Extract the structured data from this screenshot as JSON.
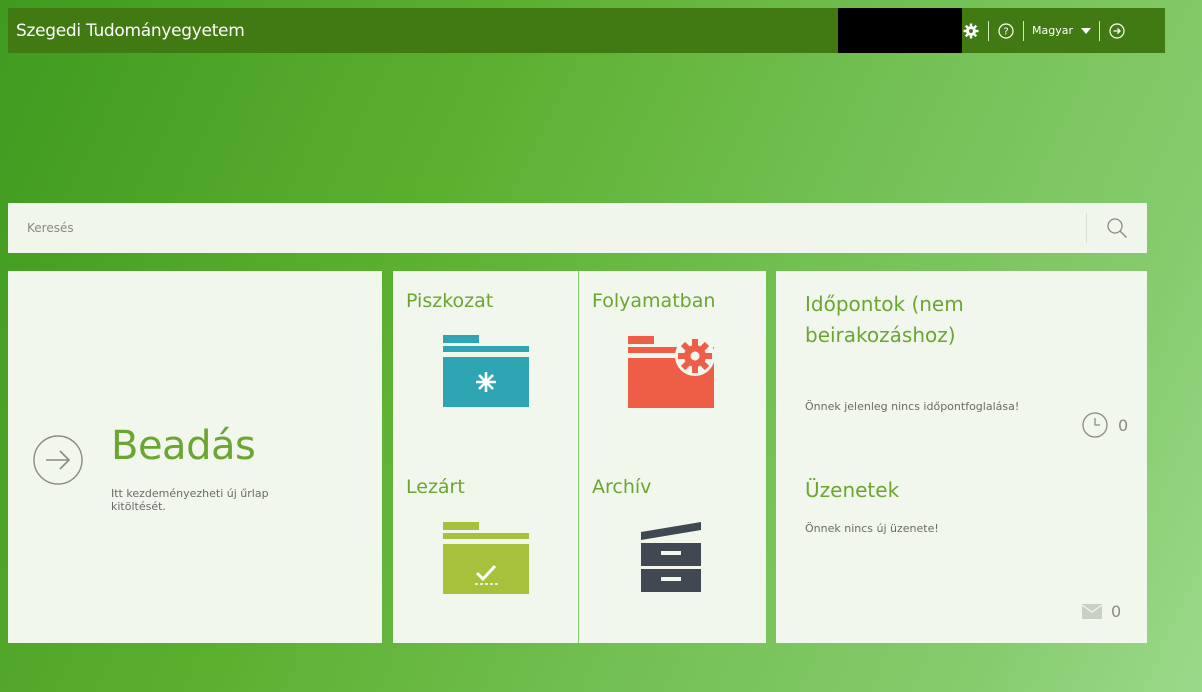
{
  "topbar": {
    "title": "Szegedi Tudományegyetem",
    "language": "Magyar"
  },
  "search": {
    "placeholder": "Keresés"
  },
  "submit_tile": {
    "title": "Beadás",
    "description": "Itt kezdeményezheti új űrlap kitöltését."
  },
  "folders": {
    "draft": "Piszkozat",
    "in_progress": "Folyamatban",
    "closed": "Lezárt",
    "archive": "Archív"
  },
  "appointments": {
    "title": "Időpontok (nem beirakozáshoz)",
    "empty_text": "Önnek jelenleg nincs időpontfoglalása!",
    "count": "0"
  },
  "messages": {
    "title": "Üzenetek",
    "empty_text": "Önnek nincs új üzenete!",
    "count": "0"
  },
  "colors": {
    "topbar": "#417a12",
    "accent_green": "#6aa630",
    "folder_teal": "#2fa5b4",
    "folder_red": "#ee5e47",
    "folder_lime": "#a6c23d",
    "archive_dark": "#404852",
    "tile_bg": "#f2f7ee"
  },
  "icons": {
    "settings": "gear-icon",
    "help": "help-icon",
    "logout": "logout-icon",
    "search": "search-icon",
    "submit": "arrow-circle-icon",
    "appointments": "clock-icon",
    "messages": "mail-icon"
  }
}
